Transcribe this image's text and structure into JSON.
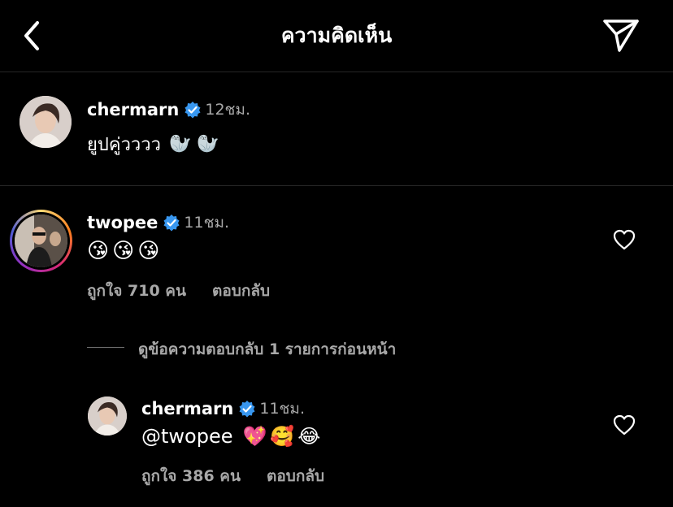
{
  "header": {
    "title": "ความคิดเห็น",
    "back_icon": "chevron-left-icon",
    "share_icon": "paper-plane-icon"
  },
  "colors": {
    "background": "#000000",
    "verified": "#3897f0",
    "secondary_text": "#a8a8a8",
    "divider": "#262626"
  },
  "caption": {
    "username": "chermarn",
    "time": "12ชม.",
    "text": "ยูปคู่วววว",
    "emojis": "🦭 🦭"
  },
  "comment": {
    "username": "twopee",
    "time": "11ชม.",
    "emojis": "😘😘😘",
    "likes": "ถูกใจ 710 คน",
    "reply_label": "ตอบกลับ"
  },
  "view_replies": "ดูข้อความตอบกลับ 1 รายการก่อนหน้า",
  "reply": {
    "username": "chermarn",
    "time": "11ชม.",
    "mention": "@twopee",
    "emojis": "💖🥰😂",
    "likes": "ถูกใจ 386 คน",
    "reply_label": "ตอบกลับ"
  }
}
